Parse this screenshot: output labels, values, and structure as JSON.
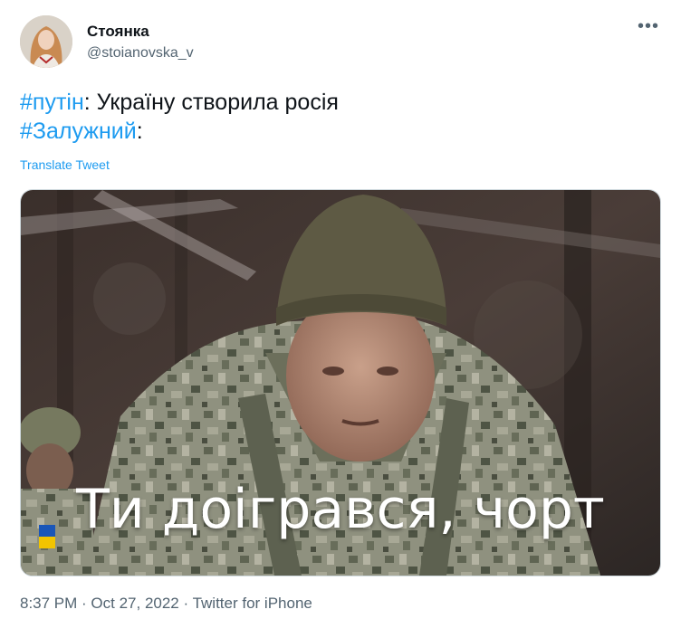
{
  "author": {
    "display_name": "Стоянка",
    "handle": "@stoianovska_v"
  },
  "tweet": {
    "line1_hashtag": "#путін",
    "line1_rest": ": Україну створила росія",
    "line2_hashtag": "#Залужний",
    "line2_rest": ":",
    "translate_label": "Translate Tweet",
    "more_icon": "•••"
  },
  "media": {
    "caption": "Ти доігрався, чорт"
  },
  "meta": {
    "time": "8:37 PM",
    "sep1": " · ",
    "date": "Oct 27, 2022",
    "sep2": " · ",
    "source": "Twitter for iPhone"
  },
  "colors": {
    "link": "#1d9bf0",
    "text": "#0f1419",
    "secondary": "#536471"
  }
}
